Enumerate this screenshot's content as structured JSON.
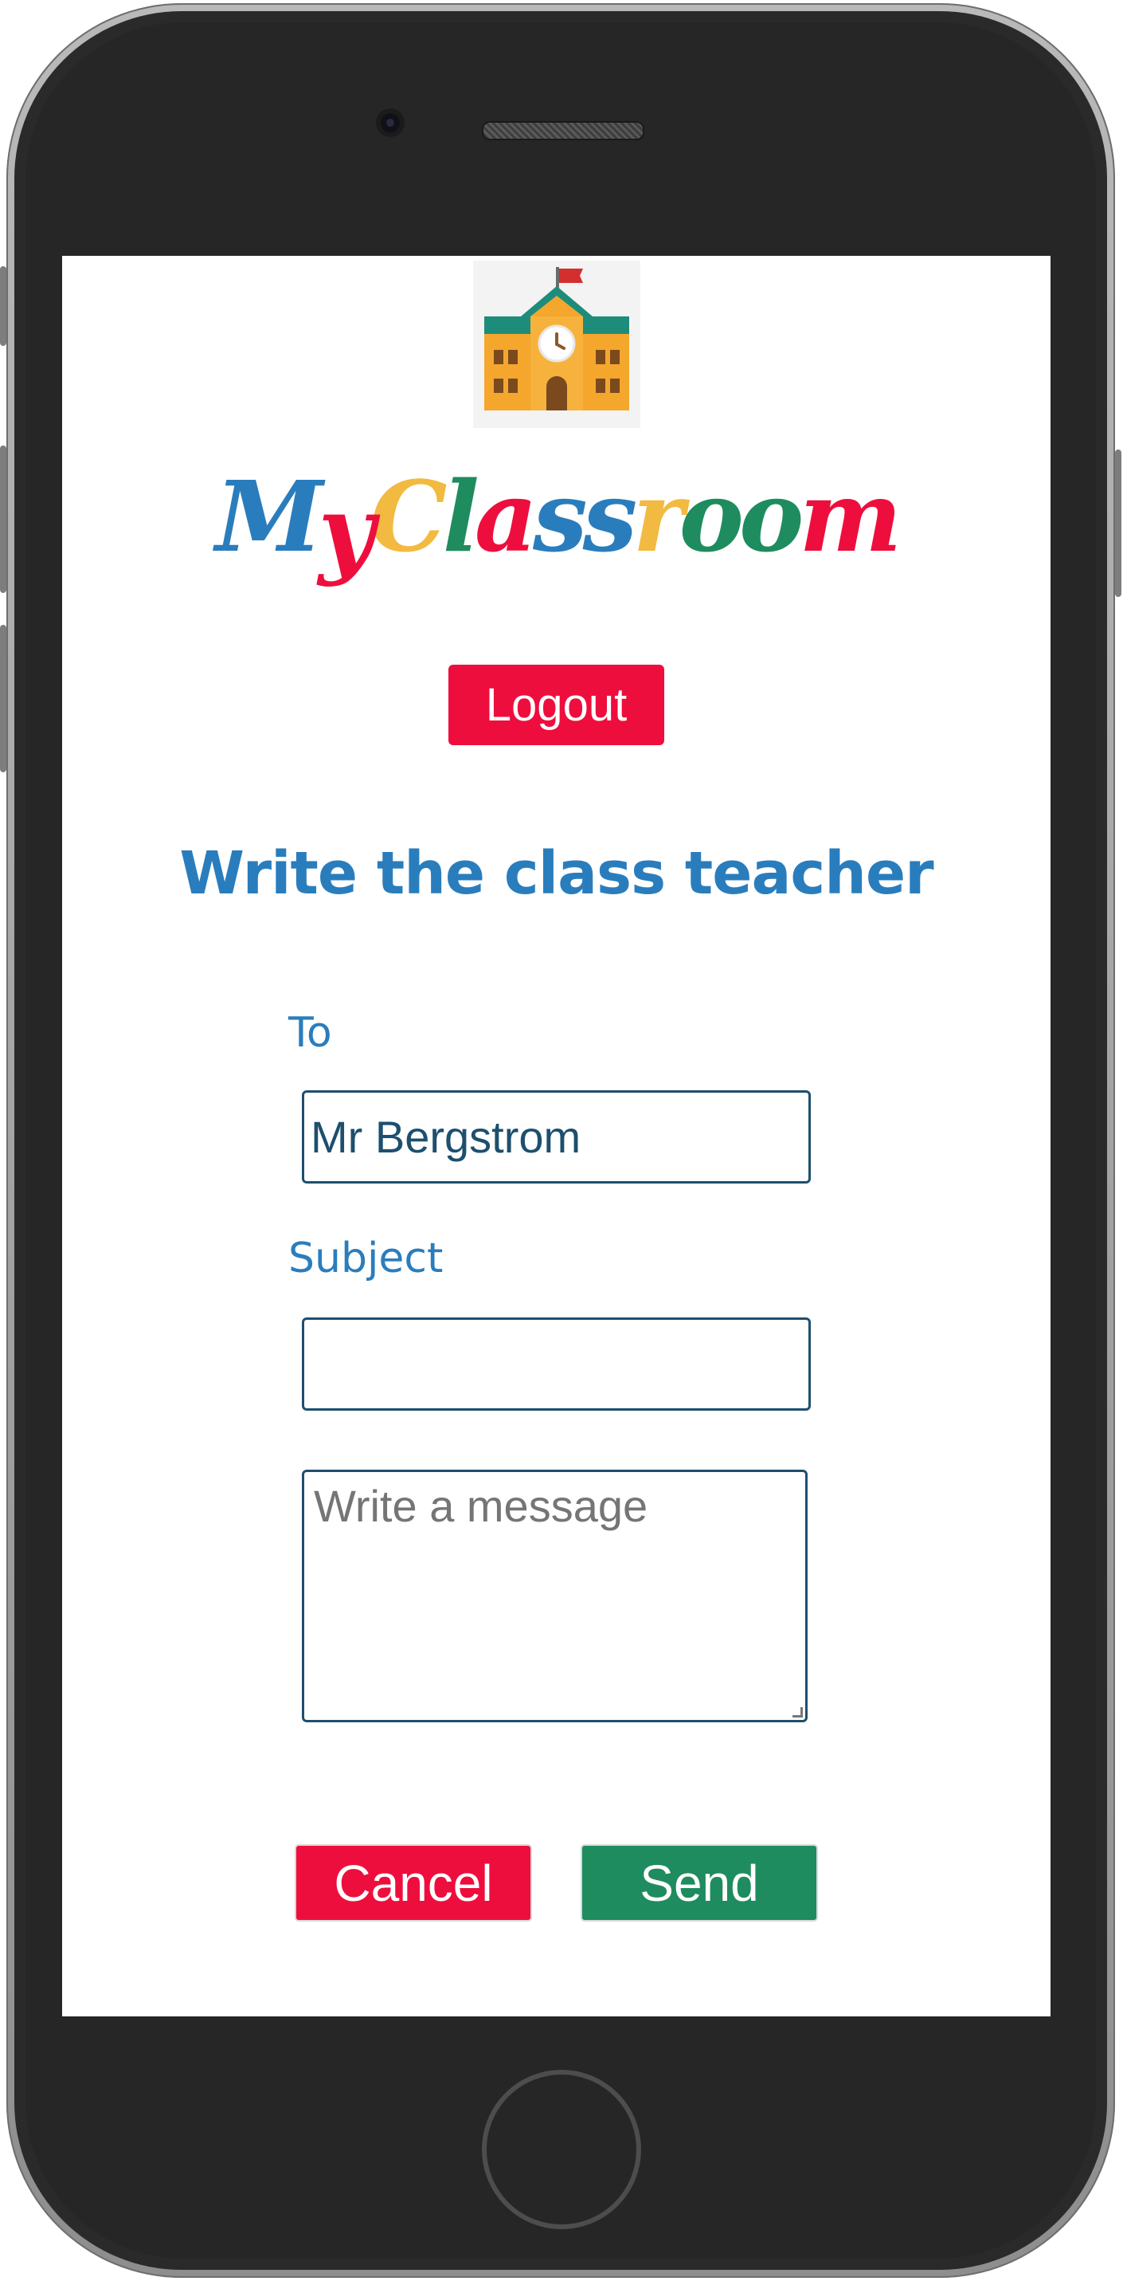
{
  "app": {
    "name_letters": [
      "M",
      "y",
      "C",
      "l",
      "a",
      "s",
      "s",
      "r",
      "o",
      "o",
      "m"
    ],
    "name_colors": [
      "#2a7dbd",
      "#ee0e3d",
      "#f2ba40",
      "#1e8c5e",
      "#ee0e3d",
      "#2a7dbd",
      "#2a7dbd",
      "#f2ba40",
      "#1e8c5e",
      "#1e8c5e",
      "#ee0e3d"
    ],
    "logo_icon": "school-building-icon"
  },
  "header": {
    "logout_label": "Logout"
  },
  "page": {
    "title": "Write the class teacher"
  },
  "form": {
    "to_label": "To",
    "to_value": "Mr Bergstrom",
    "subject_label": "Subject",
    "subject_value": "",
    "message_placeholder": "Write a message",
    "cancel_label": "Cancel",
    "send_label": "Send"
  },
  "colors": {
    "accent_blue": "#2a7dbd",
    "danger_red": "#ee0e3d",
    "success_green": "#1e8c5e",
    "brand_yellow": "#f2ba40"
  }
}
